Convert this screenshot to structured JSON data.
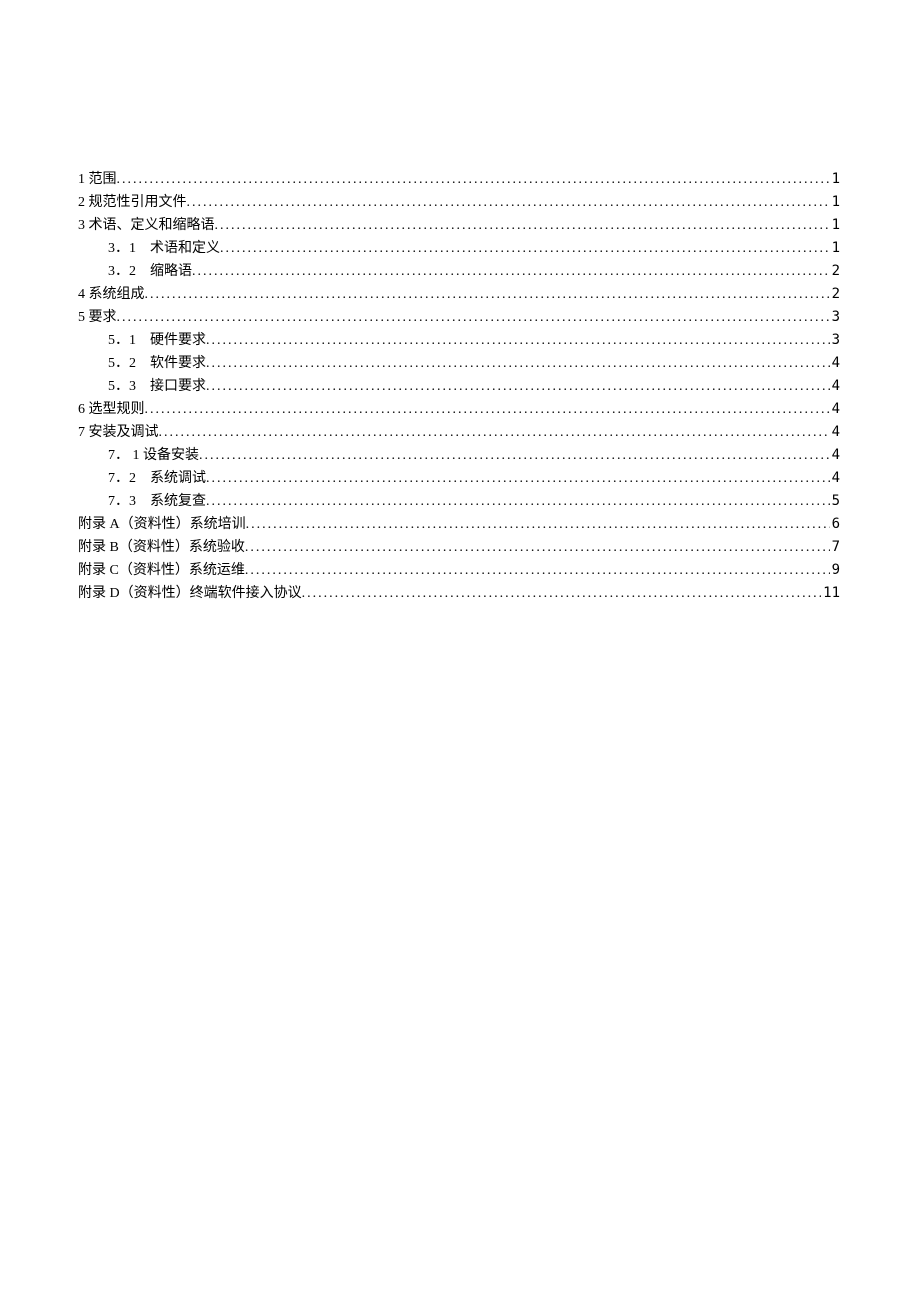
{
  "toc": [
    {
      "level": 1,
      "label": "1 范围",
      "page": "1"
    },
    {
      "level": 1,
      "label": "2 规范性引用文件",
      "page": "1"
    },
    {
      "level": 1,
      "label": "3 术语、定义和缩略语",
      "page": "1"
    },
    {
      "level": 2,
      "label": "3．1　术语和定义 ",
      "page": "1"
    },
    {
      "level": 2,
      "label": "3．2　缩略语 ",
      "page": "2"
    },
    {
      "level": 1,
      "label": "4 系统组成",
      "page": "2"
    },
    {
      "level": 1,
      "label": "5 要求",
      "page": "3"
    },
    {
      "level": 2,
      "label": "5．1　硬件要求 ",
      "page": "3"
    },
    {
      "level": 2,
      "label": "5．2　软件要求 ",
      "page": "4"
    },
    {
      "level": 2,
      "label": "5．3　接口要求 ",
      "page": "4"
    },
    {
      "level": 1,
      "label": "6 选型规则",
      "page": "4"
    },
    {
      "level": 1,
      "label": "7 安装及调试",
      "page": "4"
    },
    {
      "level": 2,
      "label": "7． 1 设备安装 ",
      "page": "4"
    },
    {
      "level": 2,
      "label": "7．2　系统调试 ",
      "page": "4"
    },
    {
      "level": 2,
      "label": "7．3　系统复查 ",
      "page": "5"
    },
    {
      "level": 1,
      "label": "附录 A（资料性）系统培训",
      "page": "6"
    },
    {
      "level": 1,
      "label": "附录 B（资料性）系统验收",
      "page": "7"
    },
    {
      "level": 1,
      "label": "附录 C（资料性）系统运维",
      "page": "9"
    },
    {
      "level": 1,
      "label": "附录 D（资料性）终端软件接入协议",
      "page": "11"
    }
  ]
}
